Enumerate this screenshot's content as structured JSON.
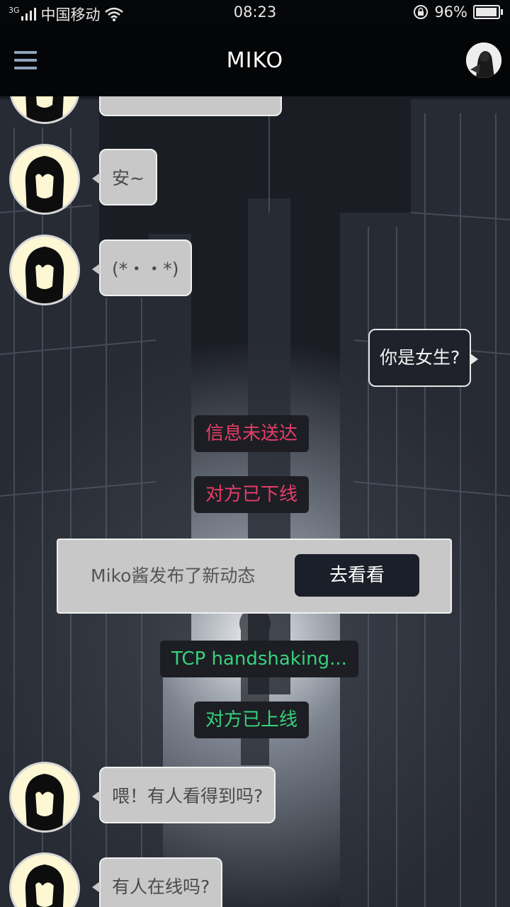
{
  "status_bar": {
    "network_type": "3G",
    "carrier": "中国移动",
    "time": "08:23",
    "battery_percent": "96%",
    "battery_level": 0.96,
    "icons": [
      "signal-icon",
      "wifi-icon",
      "rotation-lock-icon",
      "battery-icon"
    ]
  },
  "app_bar": {
    "title": "MIKO",
    "menu_icon": "hamburger-menu-icon",
    "avatar_icon": "profile-avatar-icon"
  },
  "messages": [
    {
      "type": "incoming",
      "text": "",
      "partial": true
    },
    {
      "type": "incoming",
      "text": "安~"
    },
    {
      "type": "incoming",
      "text": "(*・・*)"
    },
    {
      "type": "outgoing",
      "text": "你是女生?"
    },
    {
      "type": "system",
      "text": "信息未送达",
      "color": "#e83d67"
    },
    {
      "type": "system",
      "text": "对方已下线",
      "color": "#e83d67"
    },
    {
      "type": "card",
      "text": "Miko酱发布了新动态",
      "button": "去看看"
    },
    {
      "type": "system",
      "text": "TCP handshaking...",
      "color": "#37d27c"
    },
    {
      "type": "system",
      "text": "对方已上线",
      "color": "#37d27c"
    },
    {
      "type": "incoming",
      "text": "喂！有人看得到吗?"
    },
    {
      "type": "incoming",
      "text": "有人在线吗?"
    }
  ],
  "colors": {
    "background": "#1e2129",
    "incoming_bubble": "#c8c8c8",
    "outgoing_bubble": "#1f222b",
    "error_text": "#e83d67",
    "success_text": "#37d27c",
    "card_button": "#1b1f29"
  }
}
